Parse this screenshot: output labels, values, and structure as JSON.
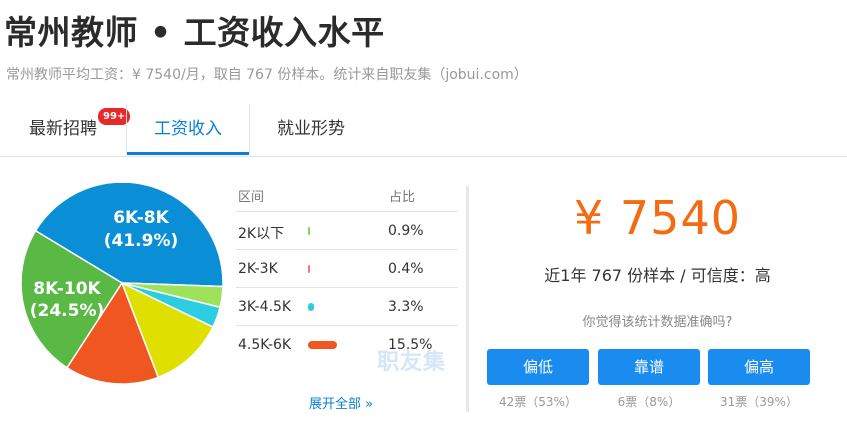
{
  "header": {
    "title": "常州教师 • 工资收入水平",
    "subtitle": "常州教师平均工资：¥ 7540/月，取自 767 份样本。统计来自职友集（jobui.com）"
  },
  "tabs": [
    {
      "label": "最新招聘",
      "badge": "99+",
      "active": false
    },
    {
      "label": "工资收入",
      "active": true
    },
    {
      "label": "就业形势",
      "active": false
    }
  ],
  "chart_data": {
    "type": "pie",
    "slices": [
      {
        "label": "6K-8K",
        "value": 41.9,
        "color": "#0a8fd6"
      },
      {
        "label": "8K-10K",
        "value": 24.5,
        "color": "#59b944"
      },
      {
        "label": "",
        "value": 15.0,
        "color": "#f0561f"
      },
      {
        "label": "",
        "value": 12.0,
        "color": "#dfe002"
      },
      {
        "label": "",
        "value": 3.3,
        "color": "#2ccde0"
      },
      {
        "label": "",
        "value": 3.3,
        "color": "#9ee25b"
      }
    ],
    "slice_labels": [
      "6K-8K",
      "(41.9%)",
      "8K-10K",
      "(24.5%)"
    ]
  },
  "table": {
    "headers": {
      "range": "区间",
      "ratio": "占比"
    },
    "rows": [
      {
        "range": "2K以下",
        "pct": "0.9%",
        "value": 0.9,
        "color": "#7ed957"
      },
      {
        "range": "2K-3K",
        "pct": "0.4%",
        "value": 0.4,
        "color": "#f07a7a"
      },
      {
        "range": "3K-4.5K",
        "pct": "3.3%",
        "value": 3.3,
        "color": "#2ccde0"
      },
      {
        "range": "4.5K-6K",
        "pct": "15.5%",
        "value": 15.5,
        "color": "#f0561f"
      }
    ],
    "expand": "展开全部 »",
    "watermark": "职友集"
  },
  "summary": {
    "salary": "¥ 7540",
    "sample": "近1年 767 份样本 / 可信度：高",
    "question": "你觉得该统计数据准确吗?"
  },
  "votes": [
    {
      "label": "偏低",
      "count": "42票（53%）"
    },
    {
      "label": "靠谱",
      "count": "6票（8%）"
    },
    {
      "label": "偏高",
      "count": "31票（39%）"
    }
  ]
}
